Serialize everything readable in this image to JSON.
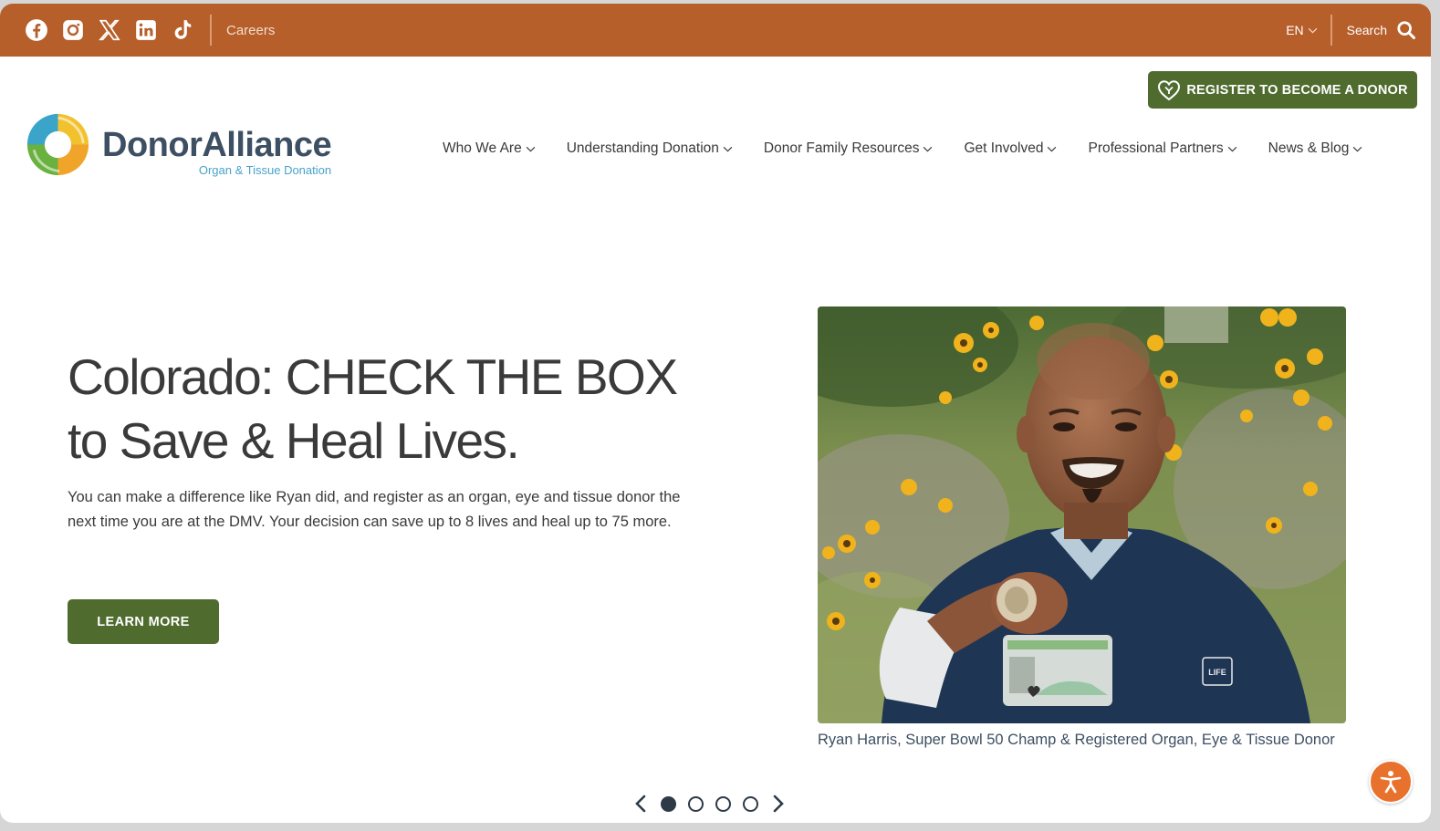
{
  "topbar": {
    "social_icons": [
      "facebook-icon",
      "instagram-icon",
      "x-icon",
      "linkedin-icon",
      "tiktok-icon"
    ],
    "careers_label": "Careers",
    "language_label": "EN",
    "search_label": "Search"
  },
  "header": {
    "logo_name": "DonorAlliance",
    "logo_subtitle": "Organ & Tissue Donation",
    "register_label": "REGISTER TO BECOME A DONOR",
    "nav": [
      {
        "label": "Who We Are"
      },
      {
        "label": "Understanding Donation"
      },
      {
        "label": "Donor Family Resources"
      },
      {
        "label": "Get Involved"
      },
      {
        "label": "Professional Partners"
      },
      {
        "label": "News & Blog"
      }
    ]
  },
  "hero": {
    "title_line1": "Colorado: CHECK THE BOX",
    "title_line2": "to Save & Heal Lives.",
    "body": "You can make a difference like Ryan did, and register as an organ, eye and tissue donor the next time you are at the DMV. Your decision can save up to 8 lives and heal up to 75 more.",
    "cta_label": "LEARN MORE",
    "photo_caption": "Ryan Harris, Super Bowl 50 Champ & Registered Organ, Eye & Tissue Donor",
    "shirt_logo": "DONATE LIFE Colorado"
  },
  "carousel": {
    "slide_count": 4,
    "active_slide": 1
  },
  "colors": {
    "topbar": "#b65f2b",
    "button_green": "#4f6b2e",
    "logo_text": "#3d4f63",
    "logo_subtitle": "#47a3cc",
    "accessibility": "#e8722d"
  }
}
